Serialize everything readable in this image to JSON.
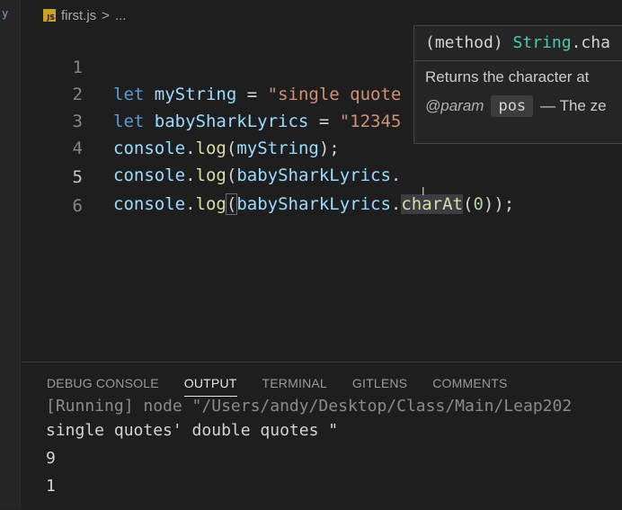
{
  "sidebar": {
    "glyph": "y"
  },
  "breadcrumb": {
    "file_icon": "JS",
    "file_name": "first.js",
    "separator": ">",
    "trail": "..."
  },
  "editor": {
    "active_line": 5,
    "lines": [
      {
        "number": "1",
        "parts": [
          "let",
          " ",
          "myString",
          " = ",
          "\"single quote"
        ]
      },
      {
        "number": "2",
        "parts": [
          "let",
          " ",
          "babySharkLyrics",
          " = ",
          "\"12345"
        ]
      },
      {
        "number": "3",
        "parts": [
          "console",
          ".",
          "log",
          "(",
          "myString",
          ");"
        ]
      },
      {
        "number": "4",
        "parts": [
          "console",
          ".",
          "log",
          "(",
          "babySharkLyrics",
          "."
        ]
      },
      {
        "number": "5",
        "parts": [
          "console",
          ".",
          "log",
          "(",
          "babySharkLyrics",
          ".",
          "charAt",
          "(",
          "0",
          ")",
          ");"
        ]
      },
      {
        "number": "6"
      }
    ]
  },
  "hover": {
    "signature_open": "(method) ",
    "signature_type": "String",
    "signature_rest": ".cha",
    "description": "Returns the character at",
    "param_tag": "@param",
    "param_name": "pos",
    "param_desc": "— The ze"
  },
  "panel": {
    "tabs": [
      "DEBUG CONSOLE",
      "OUTPUT",
      "TERMINAL",
      "GITLENS",
      "COMMENTS"
    ],
    "active_tab": "OUTPUT",
    "output_lines": [
      "[Running] node \"/Users/andy/Desktop/Class/Main/Leap202",
      "single quotes' double quotes \"",
      "9",
      "1"
    ]
  },
  "colors": {
    "background": "#1e1e1e",
    "keyword": "#569cd6",
    "variable": "#9cdcfe",
    "string": "#ce9178",
    "function": "#dcdcaa",
    "type": "#4ec9b0",
    "number": "#b5cea8"
  }
}
